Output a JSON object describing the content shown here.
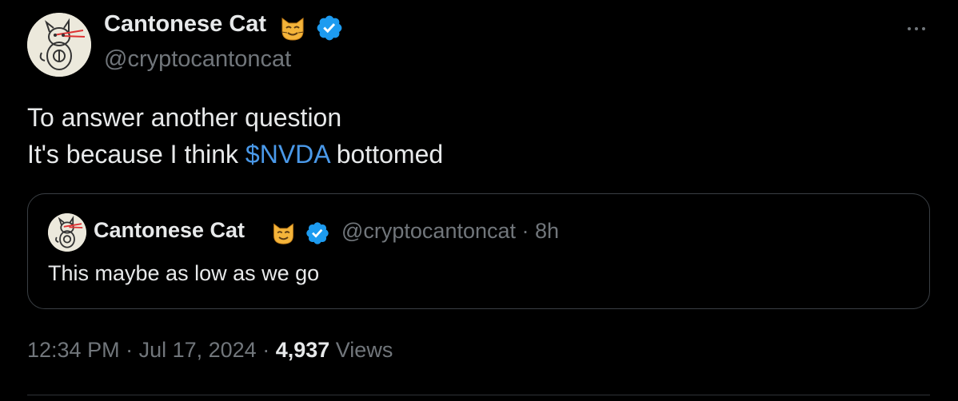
{
  "tweet": {
    "author": {
      "name": "Cantonese Cat",
      "handle": "@cryptocantoncat",
      "avatar_icon": "cat-sketch-avatar",
      "name_emoji": "cat-face-emoji",
      "verified_icon": "verified-badge-icon"
    },
    "text_line1": "To answer another question",
    "text_line2_before": "It's because I think ",
    "cashtag": "$NVDA",
    "text_line2_after": " bottomed",
    "more_icon": "more-options-icon",
    "quote": {
      "name": "Cantonese Cat",
      "handle": "@cryptocantoncat",
      "separator": " · ",
      "age": "8h",
      "text": "This maybe as low as we go"
    },
    "meta": {
      "time": "12:34 PM",
      "separator": " · ",
      "date": "Jul 17, 2024",
      "views_count": "4,937",
      "views_label": " Views"
    }
  },
  "colors": {
    "background": "#000000",
    "primary_text": "#e7e9ea",
    "secondary_text": "#71767b",
    "link": "#4a99e9",
    "verified": "#1d9bf0",
    "border": "#3a3f44"
  }
}
